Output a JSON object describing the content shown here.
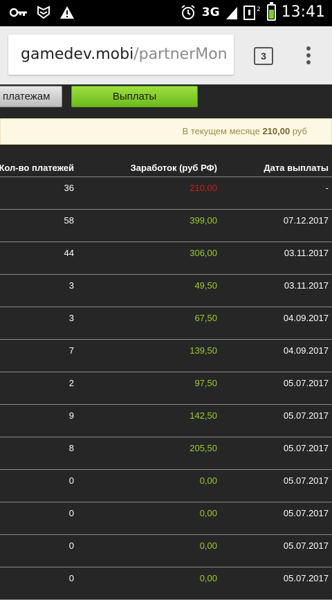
{
  "status": {
    "time": "13:41",
    "network": "3G",
    "colors": {
      "battery": "#7ed321"
    },
    "left_icons": [
      "key-icon",
      "shield-icon",
      "warning-icon"
    ],
    "right_icons": [
      "alarm-icon",
      "signal-icon",
      "sim2-icon",
      "battery-icon"
    ]
  },
  "browser": {
    "url_host": "gamedev.mobi",
    "url_path": "/partnerMon",
    "tab_count": "3"
  },
  "tabs": {
    "payments": "платежам",
    "payouts": "Выплаты",
    "colors": {
      "active": "#8bd13a"
    }
  },
  "notice": {
    "prefix": "В текущем месяце ",
    "amount": "210,00",
    "suffix": " руб"
  },
  "table": {
    "headers": [
      "Кол-во платежей",
      "Заработок (руб РФ)",
      "Дата выплаты"
    ],
    "colors": {
      "earnings": "#9acd32",
      "current": "#e0141b"
    },
    "rows": [
      {
        "count": "36",
        "earn": "210,00",
        "date": "-"
      },
      {
        "count": "58",
        "earn": "399,00",
        "date": "07.12.2017"
      },
      {
        "count": "44",
        "earn": "306,00",
        "date": "03.11.2017"
      },
      {
        "count": "3",
        "earn": "49,50",
        "date": "03.11.2017"
      },
      {
        "count": "3",
        "earn": "67,50",
        "date": "04.09.2017"
      },
      {
        "count": "7",
        "earn": "139,50",
        "date": "04.09.2017"
      },
      {
        "count": "2",
        "earn": "97,50",
        "date": "05.07.2017"
      },
      {
        "count": "9",
        "earn": "142,50",
        "date": "05.07.2017"
      },
      {
        "count": "8",
        "earn": "205,50",
        "date": "05.07.2017"
      },
      {
        "count": "0",
        "earn": "0,00",
        "date": "05.07.2017"
      },
      {
        "count": "0",
        "earn": "0,00",
        "date": "05.07.2017"
      },
      {
        "count": "0",
        "earn": "0,00",
        "date": "05.07.2017"
      },
      {
        "count": "0",
        "earn": "0,00",
        "date": "05.07.2017"
      }
    ]
  }
}
